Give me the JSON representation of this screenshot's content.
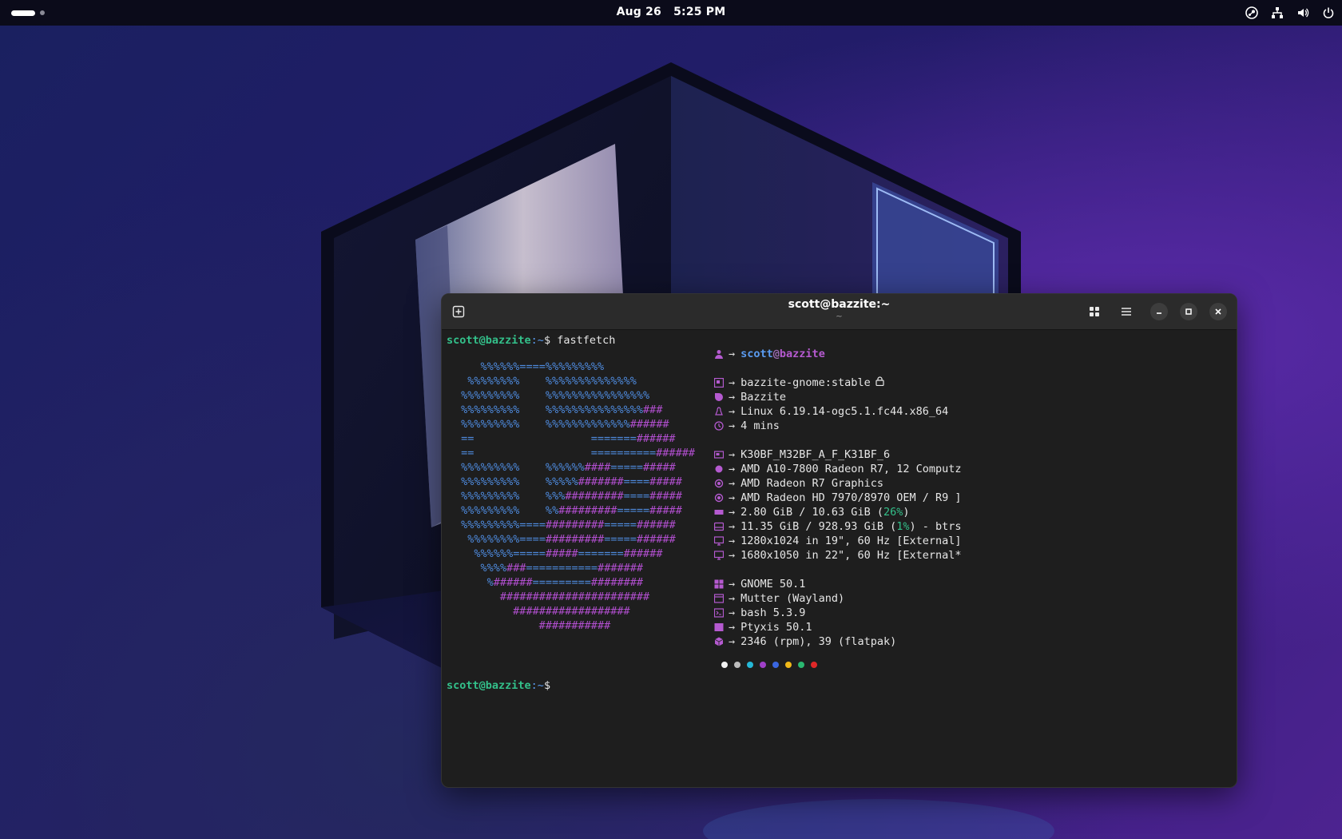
{
  "topbar": {
    "date": "Aug 26",
    "time": "5:25 PM",
    "tray_icons": [
      "steam-icon",
      "network-icon",
      "volume-icon",
      "power-icon"
    ]
  },
  "terminal": {
    "title": "scott@bazzite:~",
    "subtitle": "~",
    "prompt_user": "scott@bazzite",
    "prompt_path": ":~",
    "prompt_symbol": "$",
    "command": "fastfetch",
    "info": {
      "user": "scott",
      "at": "@",
      "host": "bazzite",
      "arrow": "→",
      "rows_group1": [
        {
          "icon": "image-icon",
          "text": "bazzite-gnome:stable",
          "lock": true
        },
        {
          "icon": "os-icon",
          "text": "Bazzite"
        },
        {
          "icon": "linux-icon",
          "text": "Linux 6.19.14-ogc5.1.fc44.x86_64"
        },
        {
          "icon": "clock-icon",
          "text": "4 mins"
        }
      ],
      "rows_group2": [
        {
          "icon": "host-icon",
          "text": "K30BF_M32BF_A_F_K31BF_6"
        },
        {
          "icon": "cpu-icon",
          "text": "AMD A10-7800 Radeon R7, 12 Computz"
        },
        {
          "icon": "gpu-icon",
          "text": "AMD Radeon R7 Graphics"
        },
        {
          "icon": "gpu-icon",
          "text": "AMD Radeon HD 7970/8970 OEM / R9 ]"
        }
      ],
      "memory": {
        "pre": "2.80 GiB / 10.63 GiB (",
        "pct": "26%",
        "post": ")"
      },
      "disk": {
        "pre": "11.35 GiB / 928.93 GiB (",
        "pct": "1%",
        "post": ") - btrs"
      },
      "displays": [
        "1280x1024 in 19\", 60 Hz [External]",
        "1680x1050 in 22\", 60 Hz [External*"
      ],
      "rows_group3": [
        {
          "icon": "de-icon",
          "text": "GNOME 50.1"
        },
        {
          "icon": "wm-icon",
          "text": "Mutter (Wayland)"
        },
        {
          "icon": "shell-icon",
          "text": "bash 5.3.9"
        },
        {
          "icon": "terminal-icon",
          "text": "Ptyxis 50.1"
        },
        {
          "icon": "package-icon",
          "text": "2346 (rpm), 39 (flatpak)"
        }
      ],
      "palette": [
        "#f2f2f2",
        "#bdbdbd",
        "#25b8d8",
        "#a040c8",
        "#3a66e0",
        "#f0b818",
        "#2ab870",
        "#e02828"
      ]
    },
    "ascii_logo": [
      "    %%%%%%====%%%%%%%%%",
      "  %%%%%%%%    %%%%%%%%%%%%%%",
      " %%%%%%%%%    %%%%%%%%%%%%%%%%",
      " %%%%%%%%%    %%%%%%%%%%%%%%%###",
      " %%%%%%%%%    %%%%%%%%%%%%%######",
      " ==                  =======######",
      " ==                  ==========######",
      " %%%%%%%%%    %%%%%%####=====#####",
      " %%%%%%%%%    %%%%%#######====#####",
      " %%%%%%%%%    %%%#########====#####",
      " %%%%%%%%%    %%#########=====#####",
      " %%%%%%%%%====#########=====######",
      "  %%%%%%%%====#########=====######",
      "   %%%%%%=====#####=======######",
      "    %%%%###===========#######",
      "     %######=========########",
      "       #######################",
      "         ##################",
      "             ###########"
    ]
  }
}
